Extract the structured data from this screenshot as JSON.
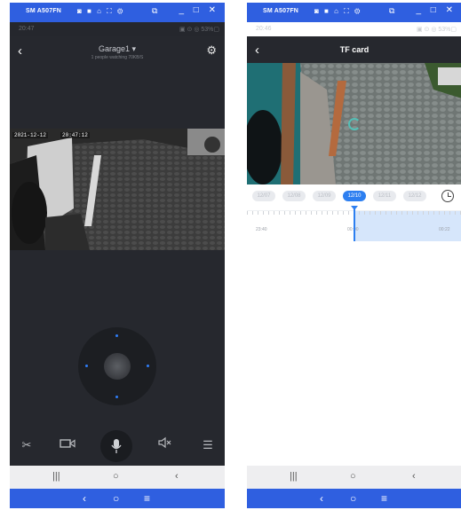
{
  "window": {
    "title": "SM A507FN",
    "status_icons": "◙ ■ ⌂ ⛶ ⚙",
    "cast_icon": "⧉",
    "controls": "_ □ ✕"
  },
  "left": {
    "status": {
      "time": "20:47",
      "right": "▣ ⊙ ◎ 53%▢"
    },
    "header": {
      "back": "‹",
      "title": "Garage1 ▾",
      "subtitle": "1 people watching  70KB/S",
      "settings_icon": "gear-icon"
    },
    "video": {
      "osd_date": "2021-12-12",
      "osd_time": "20:47:12"
    },
    "toolbar": {
      "scissors": "✂",
      "record": "▭",
      "mic": "🎤",
      "mute": "🔇",
      "menu": "☰"
    }
  },
  "right": {
    "status": {
      "time": "20:46",
      "right": "▣ ⊙ ◎ 53%▢"
    },
    "header": {
      "back": "‹",
      "title": "TF card"
    },
    "dates": [
      "12/07",
      "12/08",
      "12/09",
      "12/10",
      "12/11",
      "12/12"
    ],
    "active_date_index": 3,
    "timeline": {
      "labels": [
        "23:40",
        "00:00",
        "00:22"
      ]
    }
  },
  "system_nav": {
    "recents": "|||",
    "home": "○",
    "back": "‹"
  },
  "device_nav": {
    "back": "‹",
    "home": "○",
    "menu": "≡"
  }
}
